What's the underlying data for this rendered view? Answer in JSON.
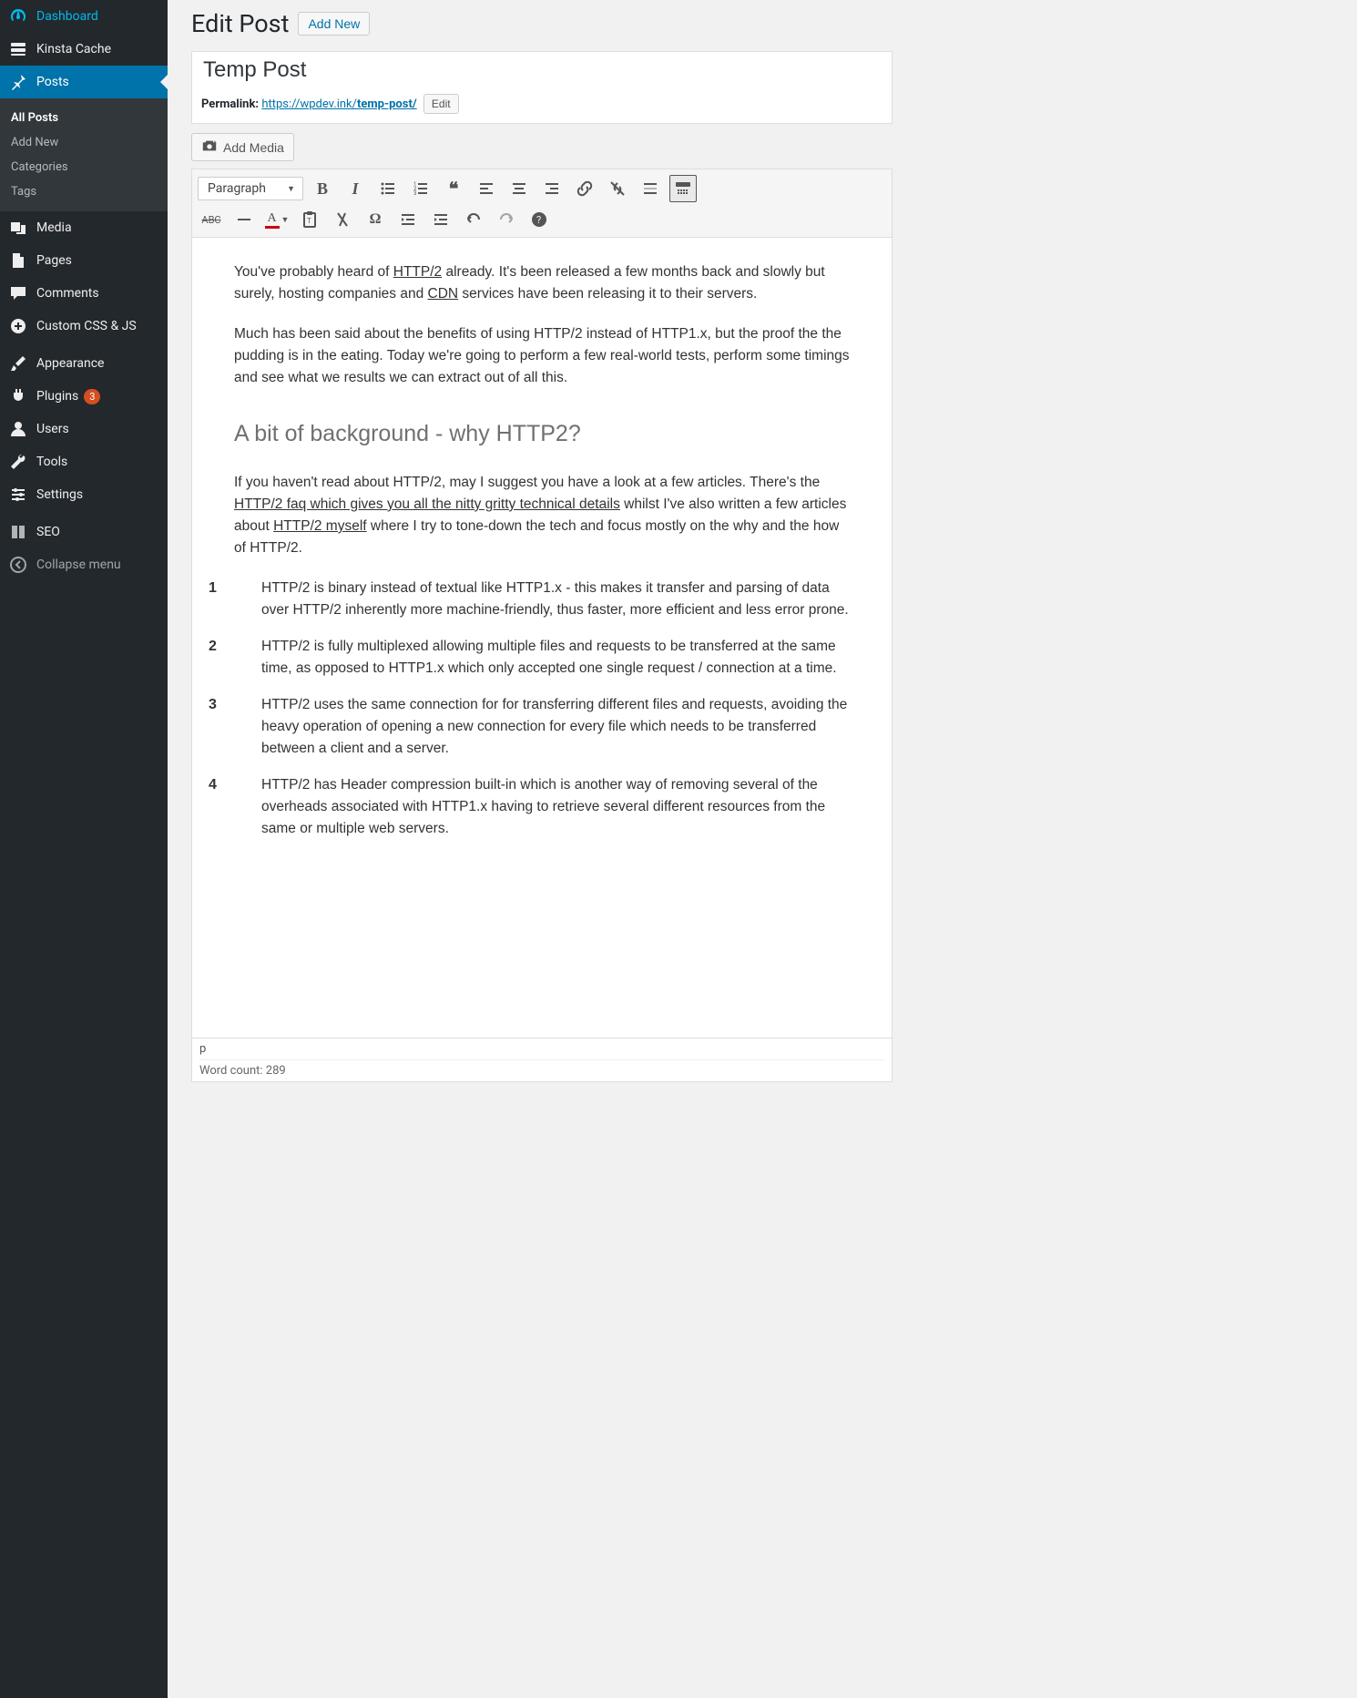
{
  "sidebar": {
    "items": [
      {
        "label": "Dashboard"
      },
      {
        "label": "Kinsta Cache"
      },
      {
        "label": "Posts"
      },
      {
        "label": "Media"
      },
      {
        "label": "Pages"
      },
      {
        "label": "Comments"
      },
      {
        "label": "Custom CSS & JS"
      },
      {
        "label": "Appearance"
      },
      {
        "label": "Plugins",
        "badge": "3"
      },
      {
        "label": "Users"
      },
      {
        "label": "Tools"
      },
      {
        "label": "Settings"
      },
      {
        "label": "SEO"
      }
    ],
    "posts_submenu": [
      "All Posts",
      "Add New",
      "Categories",
      "Tags"
    ],
    "collapse": "Collapse menu"
  },
  "header": {
    "page_title": "Edit Post",
    "add_new": "Add New"
  },
  "post": {
    "title": "Temp Post",
    "permalink_label": "Permalink:",
    "permalink_base": "https://wpdev.ink/",
    "permalink_slug": "temp-post/",
    "permalink_edit": "Edit"
  },
  "media_button": "Add Media",
  "toolbar": {
    "format": "Paragraph"
  },
  "content": {
    "p1_a": "You've probably heard of ",
    "p1_l1": "HTTP/2",
    "p1_b": " already. It's been released a few months back and slowly but surely, hosting companies and ",
    "p1_l2": "CDN",
    "p1_c": " services have been releasing it to their servers.",
    "p2": "Much has been said about the benefits of using HTTP/2 instead of HTTP1.x, but the proof the the pudding is in the eating. Today we're going to perform a few real-world tests, perform some timings and see what we results we can extract out of all this.",
    "h2": "A bit of background - why HTTP2?",
    "p3_a": "If you haven't read about HTTP/2, may I suggest you have a look at a few articles. There's the ",
    "p3_l1": "HTTP/2 faq which gives you all the nitty gritty technical details",
    "p3_b": " whilst I've also written a few articles about ",
    "p3_l2": "HTTP/2 myself",
    "p3_c": " where I try to tone-down the tech and focus mostly on the why and the how of HTTP/2.",
    "li1": "HTTP/2 is binary instead of textual like HTTP1.x - this makes it transfer and parsing of data over HTTP/2 inherently more machine-friendly, thus faster, more efficient and less error prone.",
    "li2": "HTTP/2 is fully multiplexed allowing multiple files and requests to be transferred at the same time, as opposed to HTTP1.x which only accepted one single request / connection at a time.",
    "li3": "HTTP/2 uses the same connection for for transferring different files and requests, avoiding the heavy operation of opening a new connection for every file which needs to be transferred between a client and a server.",
    "li4": "HTTP/2 has Header compression built-in which is another way of removing several of the overheads associated with HTTP1.x having to retrieve several different resources from the same or multiple web servers."
  },
  "status": {
    "path": "p",
    "word_count_label": "Word count: ",
    "word_count": "289"
  }
}
